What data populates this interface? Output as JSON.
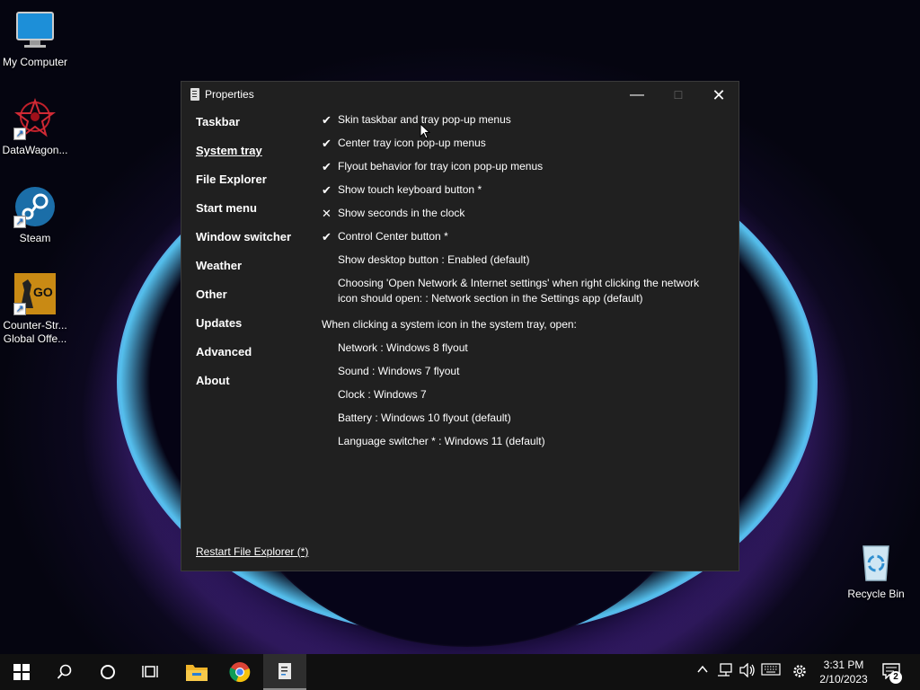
{
  "desktop": {
    "icons": [
      {
        "label": "My Computer",
        "icon": "monitor-icon"
      },
      {
        "label": "DataWagon...",
        "icon": "datawagon-icon"
      },
      {
        "label": "Steam",
        "icon": "steam-icon"
      },
      {
        "label": "Counter-Str... Global Offe...",
        "icon": "csgo-icon",
        "label1": "Counter-Str...",
        "label2": "Global Offe...",
        "badge": "GO"
      },
      {
        "label": "Recycle Bin",
        "icon": "recycle-bin-icon"
      }
    ]
  },
  "window": {
    "title": "Properties",
    "controls": {
      "minimize": "—",
      "maximize": "☐",
      "close": "✕"
    },
    "nav": [
      {
        "label": "Taskbar",
        "active": false
      },
      {
        "label": "System tray",
        "active": true
      },
      {
        "label": "File Explorer",
        "active": false
      },
      {
        "label": "Start menu",
        "active": false
      },
      {
        "label": "Window switcher",
        "active": false
      },
      {
        "label": "Weather",
        "active": false
      },
      {
        "label": "Other",
        "active": false
      },
      {
        "label": "Updates",
        "active": false
      },
      {
        "label": "Advanced",
        "active": false
      },
      {
        "label": "About",
        "active": false
      }
    ],
    "options": [
      {
        "mark": "✔",
        "text": "Skin taskbar and tray pop-up menus"
      },
      {
        "mark": "✔",
        "text": "Center tray icon pop-up menus"
      },
      {
        "mark": "✔",
        "text": "Flyout behavior for tray icon pop-up menus"
      },
      {
        "mark": "✔",
        "text": "Show touch keyboard button *"
      },
      {
        "mark": "✕",
        "text": "Show seconds in the clock"
      },
      {
        "mark": "✔",
        "text": "Control Center button *"
      },
      {
        "mark": "",
        "text": "Show desktop button : Enabled (default)"
      },
      {
        "mark": "",
        "text": "Choosing 'Open Network & Internet settings' when right clicking the network icon should open: : Network section in the Settings app (default)"
      },
      {
        "mark": "",
        "text": "When clicking a system icon in the system tray, open:"
      },
      {
        "mark": "",
        "text": "Network : Windows 8 flyout"
      },
      {
        "mark": "",
        "text": "Sound : Windows 7 flyout"
      },
      {
        "mark": "",
        "text": "Clock : Windows 7"
      },
      {
        "mark": "",
        "text": "Battery : Windows 10 flyout (default)"
      },
      {
        "mark": "",
        "text": "Language switcher * : Windows 11 (default)"
      }
    ],
    "restart_link": "Restart File Explorer (*)"
  },
  "taskbar": {
    "buttons": [
      "windows-start-icon",
      "search-icon",
      "cortana-icon",
      "task-view-icon",
      "file-explorer-icon",
      "chrome-icon",
      "properties-app-icon"
    ],
    "tray": [
      "chevron-up-icon",
      "network-icon",
      "volume-icon",
      "keyboard-icon",
      "gear-icon"
    ],
    "clock_time": "3:31 PM",
    "clock_date": "2/10/2023",
    "notification_count": "2"
  }
}
